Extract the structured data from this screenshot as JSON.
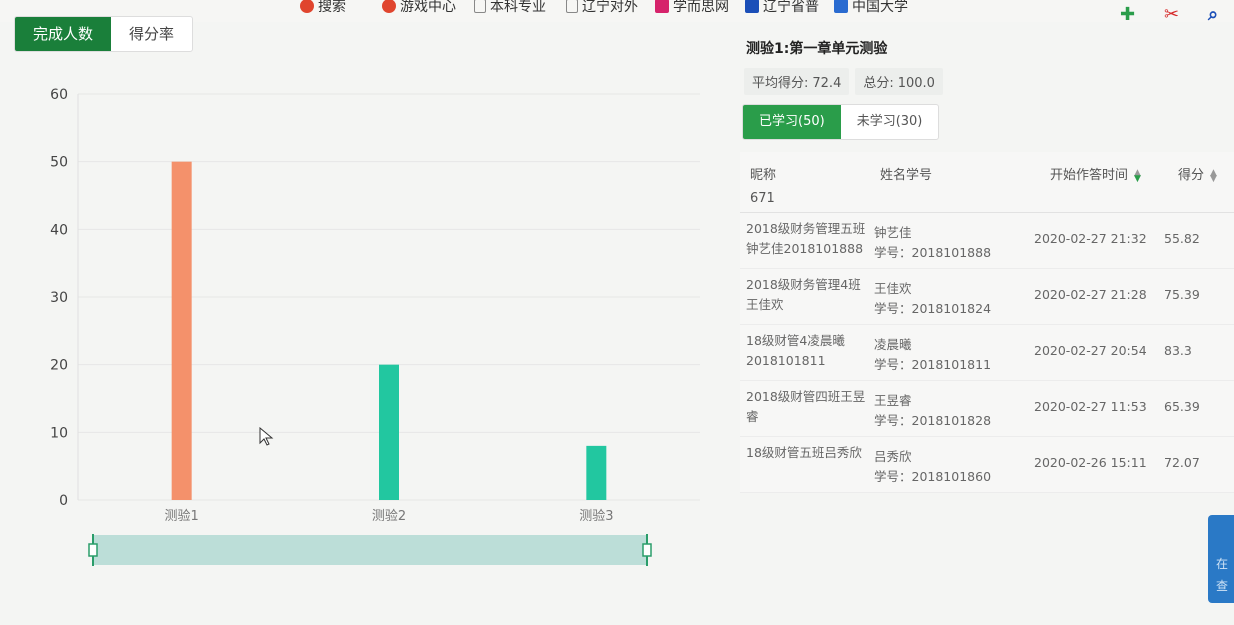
{
  "bookmarks": [
    {
      "label": "搜索",
      "color": "#e0452e"
    },
    {
      "label": "游戏中心",
      "color": "#e0452e"
    },
    {
      "label": "本科专业",
      "color": "#888888"
    },
    {
      "label": "辽宁对外",
      "color": "#888888"
    },
    {
      "label": "学而思网",
      "color": "#d6236b"
    },
    {
      "label": "辽宁省普",
      "color": "#1b4fb8"
    },
    {
      "label": "中国大学",
      "color": "#2a6bd0"
    }
  ],
  "toolbar_icons": [
    "puzzle-icon",
    "scissors-icon",
    "search-icon"
  ],
  "view_toggle": {
    "completed": "完成人数",
    "score_rate": "得分率"
  },
  "chart_data": {
    "type": "bar",
    "categories": [
      "测验1",
      "测验2",
      "测验3"
    ],
    "values": [
      50,
      20,
      8
    ],
    "colors": [
      "#f4916b",
      "#22c7a0",
      "#22c7a0"
    ],
    "ylim": [
      0,
      60
    ],
    "yticks": [
      0,
      10,
      20,
      30,
      40,
      50,
      60
    ],
    "grid": true,
    "xlabel": "",
    "ylabel": ""
  },
  "quiz": {
    "title": "测验1:第一章单元测验",
    "avg_label": "平均得分:",
    "avg_value": "72.4",
    "total_label": "总分:",
    "total_value": "100.0",
    "tab_learned": "已学习(50)",
    "tab_unlearned": "未学习(30)"
  },
  "table": {
    "headers": {
      "nick": "昵称",
      "name_id": "姓名学号",
      "start": "开始作答时间",
      "score": "得分"
    },
    "header_extra": "671",
    "rows": [
      {
        "nick": "2018级财务管理五班钟艺佳2018101888",
        "name": "钟艺佳",
        "sid": "学号：2018101888",
        "time": "2020-02-27 21:32",
        "score": "55.82"
      },
      {
        "nick": "2018级财务管理4班王佳欢",
        "name": "王佳欢",
        "sid": "学号：2018101824",
        "time": "2020-02-27 21:28",
        "score": "75.39"
      },
      {
        "nick": "18级财管4凌晨曦2018101811",
        "name": "凌晨曦",
        "sid": "学号：2018101811",
        "time": "2020-02-27 20:54",
        "score": "83.3"
      },
      {
        "nick": "2018级财管四班王昱睿",
        "name": "王昱睿",
        "sid": "学号：2018101828",
        "time": "2020-02-27 11:53",
        "score": "65.39"
      },
      {
        "nick": "18级财管五班吕秀欣",
        "name": "吕秀欣",
        "sid": "学号：2018101860",
        "time": "2020-02-26 15:11",
        "score": "72.07"
      }
    ]
  },
  "side_button": {
    "line1": "在",
    "line2": "查"
  }
}
